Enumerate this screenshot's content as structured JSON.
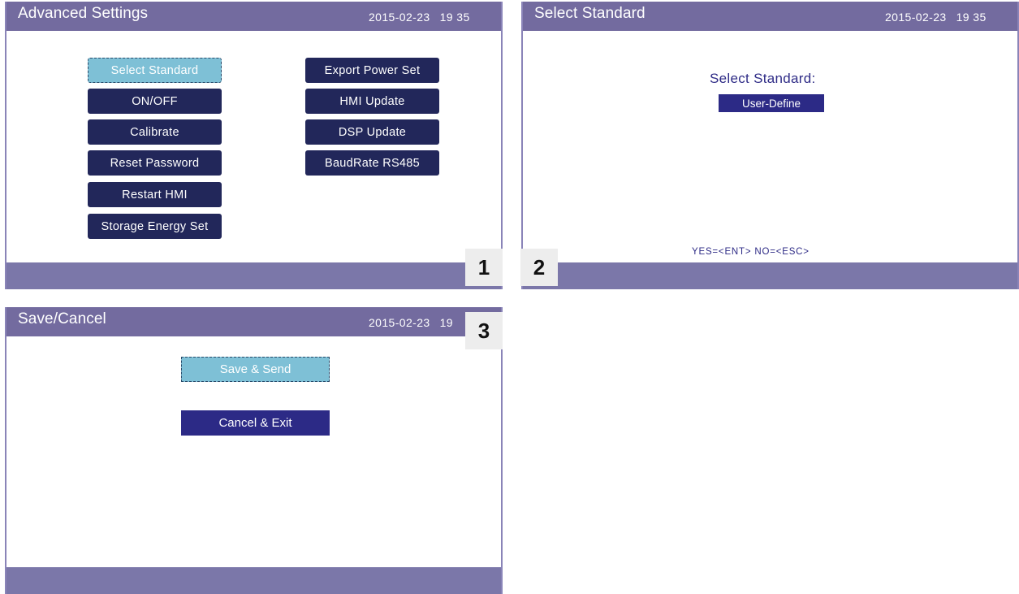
{
  "screen1": {
    "title": "Advanced Settings",
    "date": "2015-02-23",
    "time": "19 35",
    "badge": "1",
    "left_items": [
      {
        "label": "Select Standard",
        "selected": true
      },
      {
        "label": "ON/OFF",
        "selected": false
      },
      {
        "label": "Calibrate",
        "selected": false
      },
      {
        "label": "Reset Password",
        "selected": false
      },
      {
        "label": "Restart HMI",
        "selected": false
      },
      {
        "label": "Storage Energy Set",
        "selected": false
      }
    ],
    "right_items": [
      {
        "label": "Export Power Set"
      },
      {
        "label": "HMI Update"
      },
      {
        "label": "DSP Update"
      },
      {
        "label": "BaudRate RS485"
      }
    ]
  },
  "screen2": {
    "title": "Select Standard",
    "date": "2015-02-23",
    "time": "19 35",
    "badge": "2",
    "heading": "Select Standard:",
    "value": "User-Define",
    "hint": "YES=<ENT>  NO=<ESC>"
  },
  "screen3": {
    "title": "Save/Cancel",
    "date": "2015-02-23",
    "time": "19",
    "badge": "3",
    "save_label": "Save & Send",
    "cancel_label": "Cancel & Exit"
  },
  "colors": {
    "titlebar": "#736b9f",
    "footer": "#7b77a9",
    "button": "#22275a",
    "selected_button": "#7ec0d6",
    "accent_text": "#2e2b86"
  }
}
